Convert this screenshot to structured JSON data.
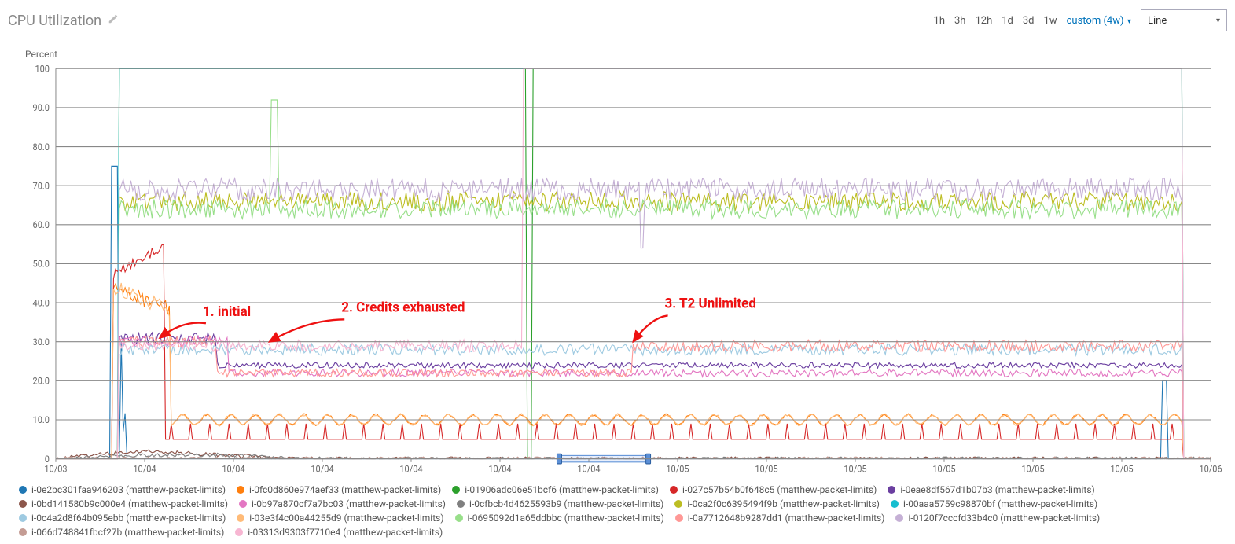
{
  "header": {
    "title": "CPU Utilization",
    "edit_icon": "pencil-icon",
    "ranges": [
      "1h",
      "3h",
      "12h",
      "1d",
      "3d",
      "1w"
    ],
    "custom_label": "custom (4w)",
    "chart_type": "Line"
  },
  "axes": {
    "ylabel": "Percent",
    "yticks": [
      0,
      "10.0",
      "20.0",
      "30.0",
      "40.0",
      "50.0",
      "60.0",
      "70.0",
      "80.0",
      "90.0",
      100
    ],
    "xticks": [
      "10/03",
      "10/04",
      "10/04",
      "10/04",
      "10/04",
      "10/04",
      "10/04",
      "10/05",
      "10/05",
      "10/05",
      "10/05",
      "10/05",
      "10/05",
      "10/06"
    ]
  },
  "annotations": [
    {
      "id": "initial",
      "text": "1. initial"
    },
    {
      "id": "credits",
      "text": "2. Credits exhausted"
    },
    {
      "id": "unlimited",
      "text": "3. T2 Unlimited"
    }
  ],
  "legend_suffix": "(matthew-packet-limits)",
  "legend": [
    {
      "id": "i-0e2bc301faa946203",
      "color": "#1f77b4"
    },
    {
      "id": "i-0fc0d860e974aef33",
      "color": "#ff7f0e"
    },
    {
      "id": "i-01906adc06e51bcf6",
      "color": "#2ca02c"
    },
    {
      "id": "i-027c57b54b0f648c5",
      "color": "#d62728"
    },
    {
      "id": "i-0eae8df567d1b07b3",
      "color": "#6b3fa0"
    },
    {
      "id": "i-0bd141580b9c000e4",
      "color": "#8c564b"
    },
    {
      "id": "i-0b97a870cf7a7bc03",
      "color": "#e377c2"
    },
    {
      "id": "i-0cfbcb4d4625593b9",
      "color": "#7f7f7f"
    },
    {
      "id": "i-0ca2f0c6395494f9b",
      "color": "#bcbd22"
    },
    {
      "id": "i-00aaa5759c98870bf",
      "color": "#17becf"
    },
    {
      "id": "i-0c4a2d8f64b095ebb",
      "color": "#9ecae1"
    },
    {
      "id": "i-03e3f4c00a44255d9",
      "color": "#ffbb78"
    },
    {
      "id": "i-0695092d1a65ddbbc",
      "color": "#98df8a"
    },
    {
      "id": "i-0a7712648b9287dd1",
      "color": "#ff9896"
    },
    {
      "id": "i-0120f7cccfd33b4c0",
      "color": "#c5b0d5"
    },
    {
      "id": "i-066d748841fbcf27b",
      "color": "#c49c94"
    },
    {
      "id": "i-03313d9303f7710e4",
      "color": "#f7b6d2"
    }
  ],
  "chart_data": {
    "type": "line",
    "title": "CPU Utilization",
    "xlabel": "",
    "ylabel": "Percent",
    "ylim": [
      0,
      100
    ],
    "x_categories": [
      "10/03",
      "10/04",
      "10/04",
      "10/04",
      "10/04",
      "10/04",
      "10/04",
      "10/05",
      "10/05",
      "10/05",
      "10/05",
      "10/05",
      "10/05",
      "10/06"
    ],
    "brush_range_x": [
      0.436,
      0.513
    ],
    "series": [
      {
        "name": "i-0e2bc301faa946203",
        "color": "#1f77b4",
        "approx": "spike to ~75 at start, then ~0, brief 20 spike near end",
        "values": [
          0,
          75,
          0,
          0,
          0,
          0,
          0,
          0,
          0,
          0,
          0,
          0,
          0,
          20,
          0
        ]
      },
      {
        "name": "i-0fc0d860e974aef33",
        "color": "#ff7f0e",
        "approx": "~45 initial burst, drops to ~10 oscillation, occasional spikes",
        "values": [
          0,
          45,
          42,
          10,
          10,
          10,
          10,
          10,
          10,
          10,
          10,
          10,
          10,
          10,
          0
        ]
      },
      {
        "name": "i-01906adc06e51bcf6",
        "color": "#2ca02c",
        "approx": "flat ~100 after t≈0.06, single dip to 0 mid and huge spike, ends 100→0",
        "values": [
          0,
          100,
          100,
          100,
          100,
          100,
          100,
          100,
          100,
          100,
          100,
          100,
          100,
          100,
          0
        ]
      },
      {
        "name": "i-027c57b54b0f648c5",
        "color": "#d62728",
        "approx": "48→55 early, drops to ~5 sawtooth baseline",
        "values": [
          0,
          48,
          55,
          5,
          5,
          5,
          5,
          5,
          5,
          5,
          5,
          5,
          5,
          5,
          0
        ]
      },
      {
        "name": "i-0eae8df567d1b07b3",
        "color": "#6b3fa0",
        "approx": "~31 initial, settles ~24 steady",
        "values": [
          0,
          31,
          31,
          24,
          24,
          24,
          24,
          24,
          24,
          24,
          24,
          24,
          24,
          24,
          0
        ]
      },
      {
        "name": "i-0bd141580b9c000e4",
        "color": "#8c564b",
        "approx": "brief low activity near start",
        "values": [
          0,
          2,
          1,
          0,
          0,
          0,
          0,
          0,
          0,
          0,
          0,
          0,
          0,
          0,
          0
        ]
      },
      {
        "name": "i-0b97a870cf7a7bc03",
        "color": "#e377c2",
        "approx": "~30 early then merges ~22",
        "values": [
          0,
          30,
          28,
          22,
          22,
          22,
          22,
          22,
          22,
          22,
          22,
          22,
          22,
          22,
          0
        ]
      },
      {
        "name": "i-0cfbcb4d4625593b9",
        "color": "#7f7f7f",
        "approx": "very low",
        "values": [
          0,
          1,
          1,
          0,
          0,
          0,
          0,
          0,
          0,
          0,
          0,
          0,
          0,
          0,
          0
        ]
      },
      {
        "name": "i-0ca2f0c6395494f9b",
        "color": "#bcbd22",
        "approx": "noisy band 64-68 throughout",
        "values": [
          0,
          66,
          67,
          65,
          66,
          66,
          65,
          66,
          66,
          65,
          66,
          66,
          66,
          66,
          0
        ]
      },
      {
        "name": "i-00aaa5759c98870bf",
        "color": "#17becf",
        "approx": "flat 100 after start",
        "values": [
          0,
          100,
          100,
          100,
          100,
          100,
          100,
          100,
          100,
          100,
          100,
          100,
          100,
          100,
          0
        ]
      },
      {
        "name": "i-0c4a2d8f64b095ebb",
        "color": "#9ecae1",
        "approx": "~30→27 noisy steady",
        "values": [
          0,
          30,
          29,
          28,
          27,
          27,
          28,
          27,
          28,
          27,
          28,
          27,
          27,
          28,
          0
        ]
      },
      {
        "name": "i-03e3f4c00a44255d9",
        "color": "#ffbb78",
        "approx": "~45 burst then ~10 oscillation",
        "values": [
          0,
          45,
          40,
          10,
          10,
          10,
          10,
          10,
          10,
          10,
          10,
          10,
          10,
          10,
          0
        ]
      },
      {
        "name": "i-0695092d1a65ddbbc",
        "color": "#98df8a",
        "approx": "noisy 62-68, one spike to 92",
        "values": [
          0,
          65,
          66,
          92,
          65,
          64,
          64,
          64,
          64,
          64,
          64,
          64,
          64,
          64,
          0
        ]
      },
      {
        "name": "i-0a7712648b9287dd1",
        "color": "#ff9896",
        "approx": "~30 early, drops ~22, jumps back ~29 at 3rd annotation",
        "values": [
          0,
          30,
          29,
          22,
          22,
          22,
          22,
          29,
          29,
          29,
          29,
          29,
          29,
          29,
          0
        ]
      },
      {
        "name": "i-0120f7cccfd33b4c0",
        "color": "#c5b0d5",
        "approx": "noisy 66-72 band, dip to 54 once",
        "values": [
          0,
          70,
          69,
          70,
          68,
          70,
          69,
          68,
          70,
          69,
          70,
          68,
          69,
          70,
          0
        ]
      },
      {
        "name": "i-066d748841fbcf27b",
        "color": "#c49c94",
        "approx": "near 0",
        "values": [
          0,
          0,
          0,
          0,
          0,
          0,
          0,
          0,
          0,
          0,
          0,
          0,
          0,
          0,
          0
        ]
      },
      {
        "name": "i-03313d9303f7710e4",
        "color": "#f7b6d2",
        "approx": "~31 early then 100 from t≈0.41",
        "values": [
          0,
          31,
          30,
          29,
          28,
          28,
          100,
          100,
          100,
          100,
          100,
          100,
          100,
          100,
          0
        ]
      }
    ],
    "annotations": [
      {
        "text": "1. initial",
        "x_frac": 0.13,
        "y": 36,
        "target_x_frac": 0.09,
        "target_y": 31
      },
      {
        "text": "2. Credits exhausted",
        "x_frac": 0.25,
        "y": 37,
        "target_x_frac": 0.185,
        "target_y": 30
      },
      {
        "text": "3. T2 Unlimited",
        "x_frac": 0.53,
        "y": 38,
        "target_x_frac": 0.5,
        "target_y": 30
      }
    ]
  }
}
